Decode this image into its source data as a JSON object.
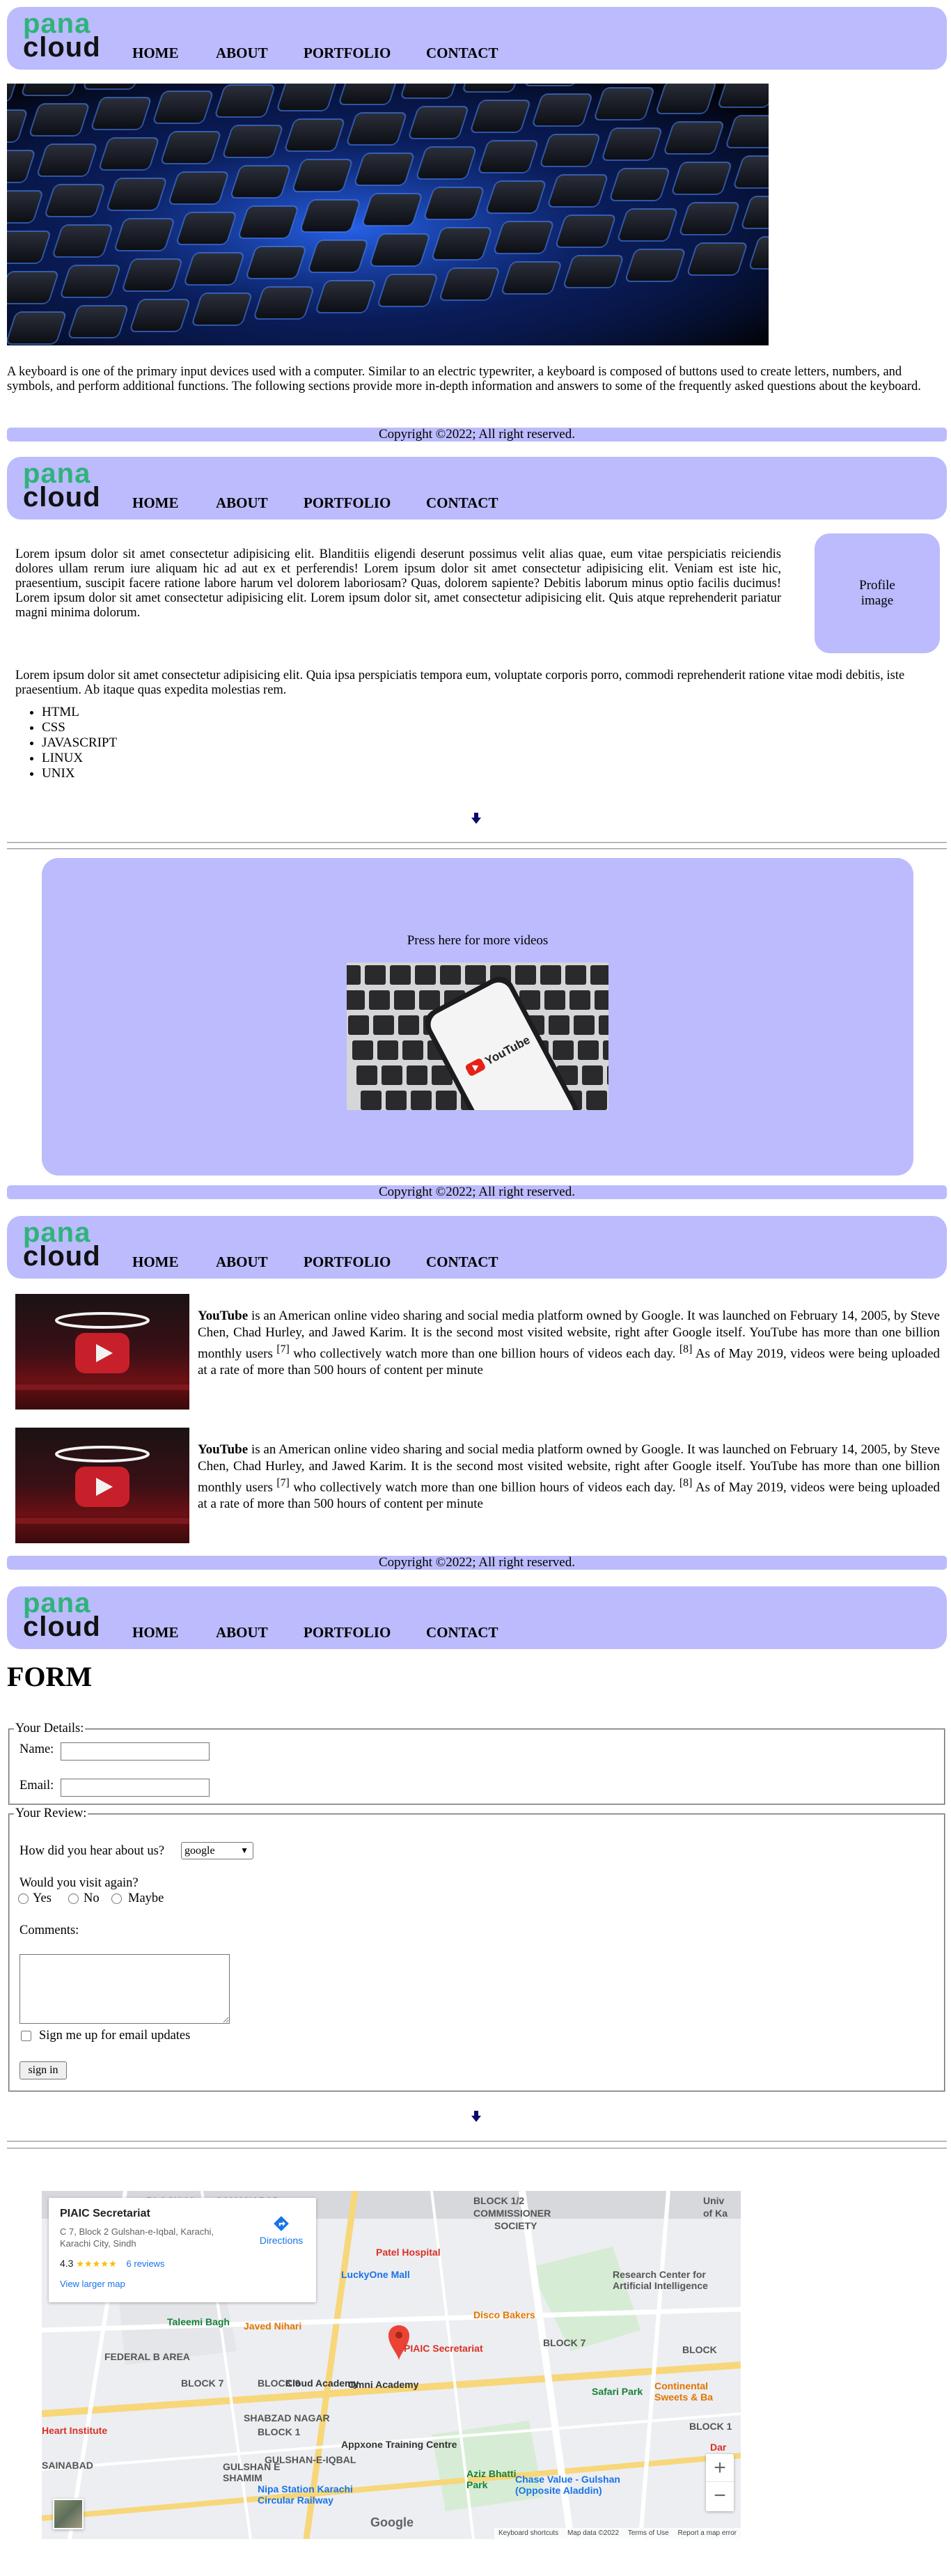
{
  "nav": {
    "logo_line1": "pana",
    "logo_line2": "cloud",
    "links": [
      "HOME",
      "ABOUT",
      "PORTFOLIO",
      "CONTACT"
    ]
  },
  "footer_text": "Copyright ©2022; All right reserved.",
  "section1": {
    "description": "A keyboard is one of the primary input devices used with a computer. Similar to an electric typewriter, a keyboard is composed of buttons used to create letters, numbers, and symbols, and perform additional functions. The following sections provide more in-depth information and answers to some of the frequently asked questions about the keyboard."
  },
  "section2": {
    "intro": "Lorem ipsum dolor sit amet consectetur adipisicing elit. Blanditiis eligendi deserunt possimus velit alias quae, eum vitae perspiciatis reiciendis dolores ullam rerum iure aliquam hic ad aut ex et perferendis! Lorem ipsum dolor sit amet consectetur adipisicing elit. Veniam est iste hic, praesentium, suscipit facere ratione labore harum vel dolorem laboriosam? Quas, dolorem sapiente? Debitis laborum minus optio facilis ducimus! Lorem ipsum dolor sit amet consectetur adipisicing elit. Lorem ipsum dolor sit, amet consectetur adipisicing elit. Quis atque reprehenderit pariatur magni minima dolorum.",
    "profile_line1": "Profile",
    "profile_line2": "image",
    "second": "Lorem ipsum dolor sit amet consectetur adipisicing elit. Quia ipsa perspiciatis tempora eum, voluptate corporis porro, commodi reprehenderit ratione vitae modi debitis, iste praesentium. Ab itaque quas expedita molestias rem.",
    "list": [
      "HTML",
      "CSS",
      "JAVASCRIPT",
      "LINUX",
      "UNIX"
    ]
  },
  "video_box": {
    "label": "Press here for more videos",
    "phone_text": "YouTube"
  },
  "youtube": {
    "bold": "YouTube",
    "rest_a": " is an American online video sharing and social media platform owned by Google. It was launched on February 14, 2005, by Steve Chen, Chad Hurley, and Jawed Karim. It is the second most visited website, right after Google itself. YouTube has more than one billion monthly users ",
    "ref1": "[7]",
    "rest_b": " who collectively watch more than one billion hours of videos each day. ",
    "ref2": "[8]",
    "rest_c": " As of May 2019, videos were being uploaded at a rate of more than 500 hours of content per minute"
  },
  "form": {
    "heading": "FORM",
    "legend_details": "Your Details:",
    "name_label": "Name:",
    "email_label": "Email:",
    "legend_review": "Your Review:",
    "hear_label": "How did you hear about us?",
    "hear_selected": "google",
    "visit_label": "Would you visit again?",
    "options": [
      "Yes",
      "No",
      "Maybe"
    ],
    "comments_label": "Comments:",
    "signup_label": "Sign me up for email updates",
    "submit": "sign in"
  },
  "map": {
    "place_title": "PIAIC Secretariat",
    "address": "C 7, Block 2 Gulshan-e-Iqbal, Karachi, Karachi City, Sindh",
    "rating": "4.3",
    "stars": "★★★★★",
    "reviews": "6 reviews",
    "directions": "Directions",
    "larger": "View larger map",
    "labels": [
      {
        "t": "BLOCK 12",
        "c": "#555"
      },
      {
        "t": "SAMANABAD",
        "c": "#555"
      },
      {
        "t": "BLOCK 1/2",
        "c": "#555"
      },
      {
        "t": "COMMISSIONER",
        "c": "#555"
      },
      {
        "t": "SOCIETY",
        "c": "#555"
      },
      {
        "t": "Patel Hospital",
        "c": "#d93025"
      },
      {
        "t": "LuckyOne Mall",
        "c": "#1a73e8"
      },
      {
        "t": "Research Center for",
        "c": "#555"
      },
      {
        "t": "Artificial Intelligence",
        "c": "#555"
      },
      {
        "t": "Disco Bakers",
        "c": "#e37400"
      },
      {
        "t": "Taleemi Bagh",
        "c": "#188038"
      },
      {
        "t": "Javed Nihari",
        "c": "#e37400"
      },
      {
        "t": "FEDERAL B AREA",
        "c": "#555"
      },
      {
        "t": "BLOCK 7",
        "c": "#555"
      },
      {
        "t": "PIAIC Secretariat",
        "c": "#d93025"
      },
      {
        "t": "BLOCK 7",
        "c": "#555"
      },
      {
        "t": "BLOCK 9",
        "c": "#555"
      },
      {
        "t": "Cloud Academy",
        "c": "#333"
      },
      {
        "t": "Omni Academy",
        "c": "#333"
      },
      {
        "t": "Safari Park",
        "c": "#188038"
      },
      {
        "t": "Continental",
        "c": "#e37400"
      },
      {
        "t": "Sweets & Ba",
        "c": "#e37400"
      },
      {
        "t": "SHABZAD NAGAR",
        "c": "#555"
      },
      {
        "t": "BLOCK 1",
        "c": "#555"
      },
      {
        "t": "Heart Institute",
        "c": "#d93025"
      },
      {
        "t": "Appxone Training Centre",
        "c": "#333"
      },
      {
        "t": "GULSHAN-E-IQBAL",
        "c": "#555"
      },
      {
        "t": "SAINABAD",
        "c": "#555"
      },
      {
        "t": "GULSHAN E",
        "c": "#555"
      },
      {
        "t": "SHAMIM",
        "c": "#555"
      },
      {
        "t": "Aziz Bhatti",
        "c": "#188038"
      },
      {
        "t": "Park",
        "c": "#188038"
      },
      {
        "t": "Chase Value - Gulshan",
        "c": "#1a73e8"
      },
      {
        "t": "(Opposite Aladdin)",
        "c": "#1a73e8"
      },
      {
        "t": "Nipa Station Karachi",
        "c": "#1a73e8"
      },
      {
        "t": "Circular Railway",
        "c": "#1a73e8"
      },
      {
        "t": "BLOCK",
        "c": "#555"
      },
      {
        "t": "BLOCK 1",
        "c": "#555"
      },
      {
        "t": "Univ",
        "c": "#555"
      },
      {
        "t": "of Ka",
        "c": "#555"
      },
      {
        "t": "Dar",
        "c": "#d93025"
      }
    ],
    "footer_items": [
      "Keyboard shortcuts",
      "Map data ©2022",
      "Terms of Use",
      "Report a map error"
    ],
    "zoom_in": "+",
    "zoom_out": "−",
    "google": "Google"
  },
  "colors": {
    "nav_bg": "#bbbbfd",
    "logo_green": "#2fb37a"
  }
}
